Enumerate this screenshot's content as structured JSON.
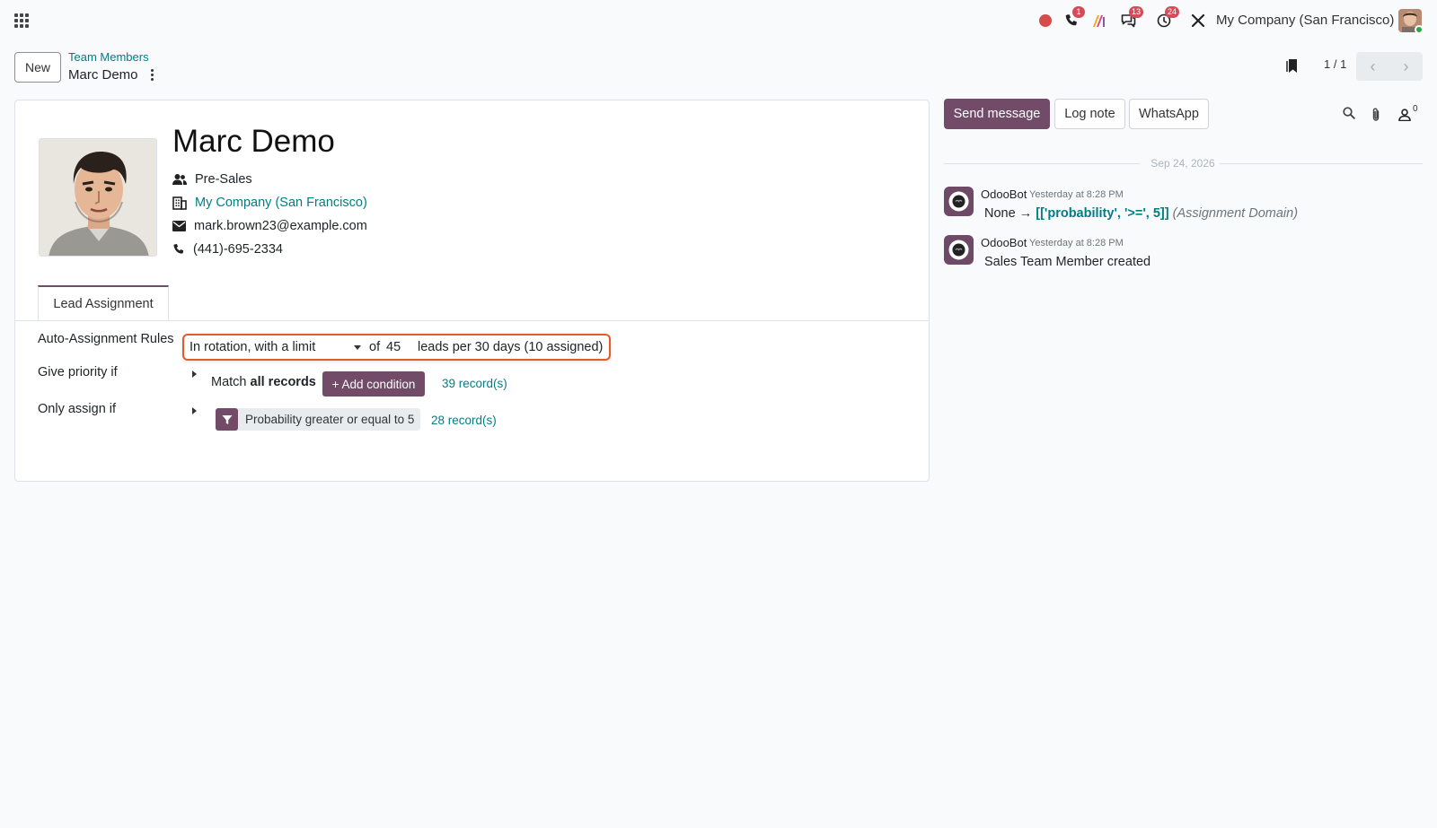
{
  "topbar": {
    "company": "My Company (San Francisco)",
    "badges": {
      "calls": "1",
      "messages": "13",
      "activities": "24"
    }
  },
  "control_panel": {
    "new_label": "New",
    "breadcrumb_parent": "Team Members",
    "breadcrumb_current": "Marc Demo",
    "pager_value": "1 / 1"
  },
  "record": {
    "name": "Marc Demo",
    "team": "Pre-Sales",
    "company": "My Company (San Francisco)",
    "email": "mark.brown23@example.com",
    "phone": "(441)-695-2334"
  },
  "tabs": {
    "lead_assignment": "Lead Assignment"
  },
  "assignment": {
    "rules_label": "Auto-Assignment Rules",
    "rules_value": "In rotation, with a limit",
    "of_label": "of",
    "limit": "45",
    "suffix": "leads per 30 days (10 assigned)",
    "priority_label": "Give priority if",
    "match_prefix": "Match",
    "match_bold": "all records",
    "add_condition": "+ Add condition",
    "priority_count": "39 record(s)",
    "only_label": "Only assign if",
    "filter_text": "Probability greater or equal to 5",
    "only_count": "28 record(s)"
  },
  "chatter": {
    "send_message": "Send message",
    "log_note": "Log note",
    "whatsapp": "WhatsApp",
    "followers": "0",
    "date": "Sep 24, 2026",
    "messages": [
      {
        "author": "OdooBot",
        "time": "Yesterday at 8:28 PM",
        "old_value": "None",
        "arrow": "→",
        "new_value": "[['probability', '>=', 5]]",
        "field": "(Assignment Domain)"
      },
      {
        "author": "OdooBot",
        "time": "Yesterday at 8:28 PM",
        "body": "Sales Team Member created"
      }
    ]
  },
  "colors": {
    "brand": "#714b67",
    "link": "#017e84",
    "highlight": "#e25c26",
    "badge": "#d44c59"
  },
  "icons": [
    "apps-icon",
    "record-icon",
    "phone-icon",
    "studio-icon",
    "chat-icon",
    "clock-icon",
    "tools-icon",
    "bookmark-icon",
    "team-icon",
    "building-icon",
    "envelope-icon",
    "phone-small-icon",
    "filter-icon",
    "search-icon",
    "paperclip-icon",
    "follower-icon",
    "robot-icon"
  ]
}
